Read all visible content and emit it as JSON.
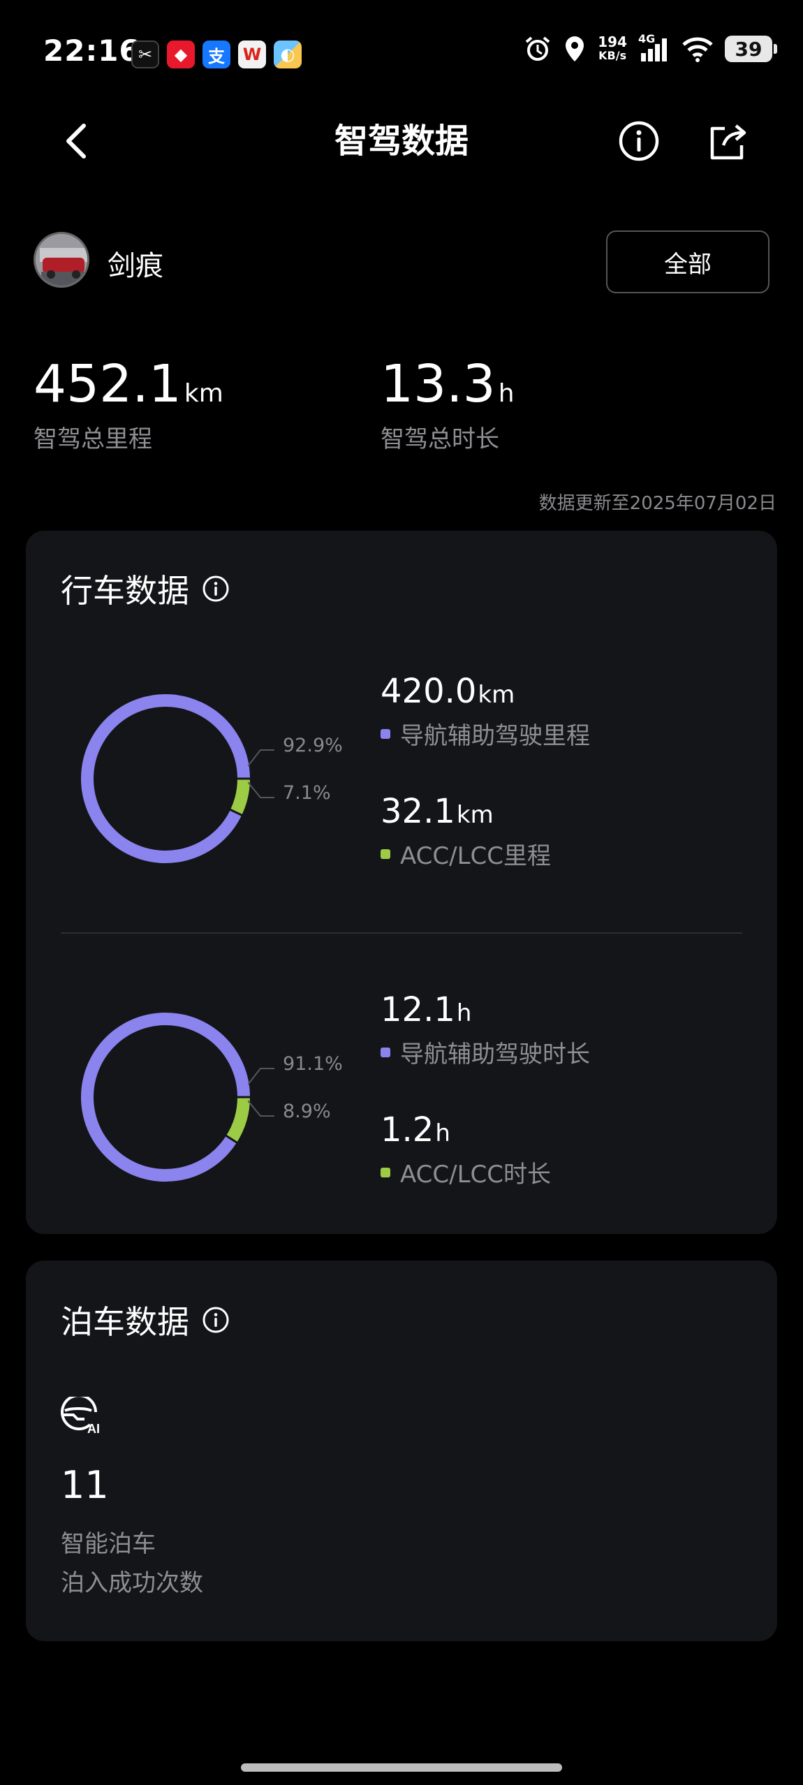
{
  "status_bar": {
    "time": "22:16",
    "speed_value": "194",
    "speed_unit": "KB/s",
    "network": "4G",
    "battery": "39",
    "app_icons": [
      "capcut-icon",
      "red-app-icon",
      "alipay-icon",
      "weibo-icon",
      "misc-app-icon"
    ],
    "app_glyphs": [
      "✂",
      "◆",
      "支",
      "W",
      "◐"
    ]
  },
  "header": {
    "title": "智驾数据"
  },
  "user": {
    "name": "剑痕",
    "filter_label": "全部"
  },
  "totals": {
    "distance_value": "452.1",
    "distance_unit": "km",
    "distance_label": "智驾总里程",
    "duration_value": "13.3",
    "duration_unit": "h",
    "duration_label": "智驾总时长",
    "update_note": "数据更新至2025年07月02日"
  },
  "driving": {
    "title": "行车数据",
    "distance_chart": {
      "pct_nav": "92.9%",
      "pct_acc": "7.1%",
      "nav_value": "420.0",
      "nav_unit": "km",
      "nav_label": "导航辅助驾驶里程",
      "acc_value": "32.1",
      "acc_unit": "km",
      "acc_label": "ACC/LCC里程"
    },
    "duration_chart": {
      "pct_nav": "91.1%",
      "pct_acc": "8.9%",
      "nav_value": "12.1",
      "nav_unit": "h",
      "nav_label": "导航辅助驾驶时长",
      "acc_value": "1.2",
      "acc_unit": "h",
      "acc_label": "ACC/LCC时长"
    }
  },
  "chart_data": [
    {
      "type": "pie",
      "categories": [
        "导航辅助驾驶里程",
        "ACC/LCC里程"
      ],
      "values": [
        420.0,
        32.1
      ],
      "percentages": [
        92.9,
        7.1
      ],
      "colors": [
        "#8b84ee",
        "#9ccc45"
      ]
    },
    {
      "type": "pie",
      "categories": [
        "导航辅助驾驶时长",
        "ACC/LCC时长"
      ],
      "values": [
        12.1,
        1.2
      ],
      "percentages": [
        91.1,
        8.9
      ],
      "colors": [
        "#8b84ee",
        "#9ccc45"
      ]
    }
  ],
  "parking": {
    "title": "泊车数据",
    "count": "11",
    "label_line1": "智能泊车",
    "label_line2": "泊入成功次数"
  },
  "colors": {
    "nav": "#8b84ee",
    "acc": "#9ccc45",
    "card_bg": "#141519",
    "muted_text": "#8e8e93"
  }
}
